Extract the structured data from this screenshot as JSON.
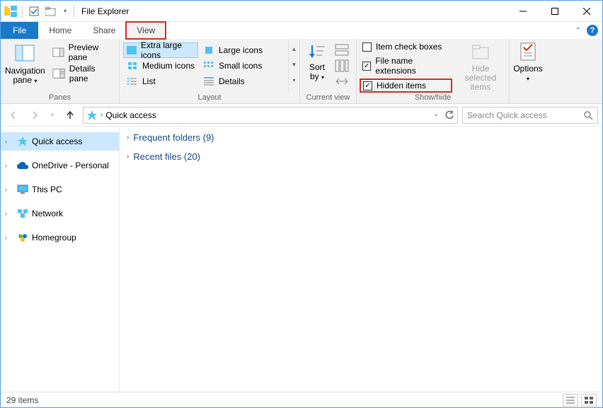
{
  "title": "File Explorer",
  "tabs": {
    "file": "File",
    "home": "Home",
    "share": "Share",
    "view": "View"
  },
  "ribbon": {
    "panes": {
      "label": "Panes",
      "navigation": "Navigation\npane",
      "preview": "Preview pane",
      "details": "Details pane"
    },
    "layout": {
      "label": "Layout",
      "items": [
        "Extra large icons",
        "Large icons",
        "Medium icons",
        "Small icons",
        "List",
        "Details"
      ]
    },
    "currentview": {
      "label": "Current view",
      "sortby": "Sort\nby"
    },
    "showhide": {
      "label": "Show/hide",
      "itemcheck": "Item check boxes",
      "fileext": "File name extensions",
      "hidden": "Hidden items",
      "hideselected": "Hide selected\nitems"
    },
    "options": "Options"
  },
  "address": {
    "location": "Quick access"
  },
  "search": {
    "placeholder": "Search Quick access"
  },
  "tree": {
    "quick": "Quick access",
    "onedrive": "OneDrive - Personal",
    "thispc": "This PC",
    "network": "Network",
    "homegroup": "Homegroup"
  },
  "content": {
    "frequent": "Frequent folders (9)",
    "recent": "Recent files (20)"
  },
  "status": {
    "items": "29 items"
  }
}
